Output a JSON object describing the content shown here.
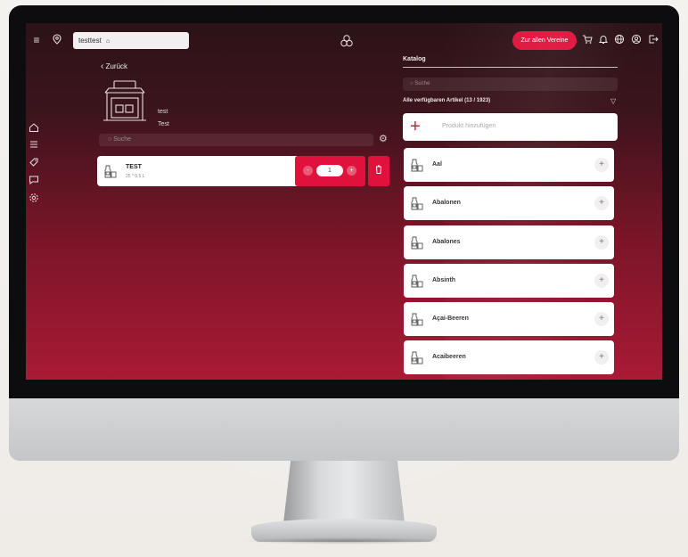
{
  "topbar": {
    "location": "testtest",
    "all_stores_button": "Zur allen Vereine"
  },
  "left": {
    "back_label": "Zurück",
    "store_name_1": "test",
    "store_name_2": "Test",
    "search_placeholder": "Suche",
    "item": {
      "title": "TEST",
      "subtitle": "25 * 0.5 L",
      "quantity": "1",
      "minus": "-",
      "plus": "+"
    }
  },
  "catalog": {
    "title": "Katalog",
    "search_placeholder": "Suche",
    "available_label": "Alle verfügbaren Artikel (13 / 1923)",
    "add_product_label": "Produkt hinzufügen",
    "items": [
      {
        "name": "Aal"
      },
      {
        "name": "Abalonen"
      },
      {
        "name": "Abalones"
      },
      {
        "name": "Absinth"
      },
      {
        "name": "Açai-Beeren"
      },
      {
        "name": "Acaibeeren"
      }
    ]
  },
  "colors": {
    "accent": "#e0123c",
    "screen_top": "#2b1318",
    "screen_bottom": "#a91a35"
  }
}
